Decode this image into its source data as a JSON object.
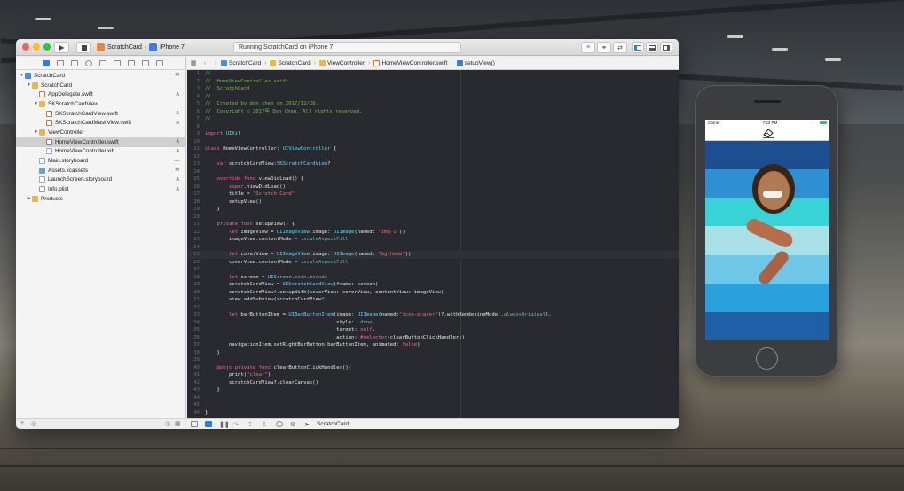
{
  "xcode": {
    "scheme": {
      "target": "ScratchCard",
      "device": "iPhone 7"
    },
    "activity": "Running ScratchCard on iPhone 7"
  },
  "navigator": {
    "items": [
      {
        "label": "ScratchCard",
        "badge": "M",
        "depth": 0,
        "kind": "proj",
        "open": true
      },
      {
        "label": "ScratchCard",
        "badge": "",
        "depth": 1,
        "kind": "folder",
        "open": true
      },
      {
        "label": "AppDelegate.swift",
        "badge": "A",
        "depth": 2,
        "kind": "swift"
      },
      {
        "label": "SKScratchCardView",
        "badge": "",
        "depth": 2,
        "kind": "folder",
        "open": true
      },
      {
        "label": "SKScratchCardView.swift",
        "badge": "A",
        "depth": 3,
        "kind": "swift"
      },
      {
        "label": "SKScratchCardMaskView.swift",
        "badge": "A",
        "depth": 3,
        "kind": "swift"
      },
      {
        "label": "ViewController",
        "badge": "",
        "depth": 2,
        "kind": "folder",
        "open": true
      },
      {
        "label": "HomeViewController.swift",
        "badge": "A",
        "depth": 3,
        "kind": "swift",
        "selected": true
      },
      {
        "label": "HomeViewController.xib",
        "badge": "A",
        "depth": 3,
        "kind": "xib"
      },
      {
        "label": "Main.storyboard",
        "badge": "—",
        "depth": 2,
        "kind": "xib"
      },
      {
        "label": "Assets.xcassets",
        "badge": "M",
        "depth": 2,
        "kind": "assets"
      },
      {
        "label": "LaunchScreen.storyboard",
        "badge": "A",
        "depth": 2,
        "kind": "xib"
      },
      {
        "label": "Info.plist",
        "badge": "A",
        "depth": 2,
        "kind": "plist"
      },
      {
        "label": "Products",
        "badge": "",
        "depth": 1,
        "kind": "folder",
        "open": false
      }
    ]
  },
  "jumpbar": {
    "items": [
      "ScratchCard",
      "ScratchCard",
      "ViewController",
      "HomeViewController.swift",
      "setupView()"
    ]
  },
  "code": {
    "highlight_line": 25,
    "lines": [
      "//",
      "//  HomeViewController.swift",
      "//  ScratchCard",
      "//",
      "//  Created by don chen on 2017/12/26.",
      "//  Copyright © 2017年 Don Chen. All rights reserved.",
      "//",
      "",
      "import UIKit",
      "",
      "class HomeViewController: UIViewController {",
      "",
      "    var scratchCardView:SKScratchCardView?",
      "",
      "    override func viewDidLoad() {",
      "        super.viewDidLoad()",
      "        title = \"Scratch Card\"",
      "        setupView()",
      "    }",
      "",
      "    private func setupView() {",
      "        let imageView = UIImageView(image: UIImage(named: \"img-1\"))",
      "        imageView.contentMode = .scaleAspectFill",
      "",
      "        let coverView = UIImageView(image: UIImage(named: \"bg-home\"))",
      "        coverView.contentMode = .scaleAspectFill",
      "",
      "        let screen = UIScreen.main.bounds",
      "        scratchCardView = SKScratchCardView(frame: screen)",
      "        scratchCardView!.setupWith(coverView: coverView, contentView: imageView)",
      "        view.addSubview(scratchCardView!)",
      "",
      "        let barButtonItem = UIBarButtonItem(image: UIImage(named:\"icon-eraser\")?.withRenderingMode(.alwaysOriginal),",
      "                                            style: .done,",
      "                                            target: self,",
      "                                            action: #selector(clearButtonClickHandler))",
      "        navigationItem.setRightBarButton(barButtonItem, animated: false)",
      "    }",
      "",
      "    @objc private func clearButtonClickHandler(){",
      "        print(\"clear\")",
      "        scratchCardView?.clearCanvas()",
      "    }",
      "",
      "",
      "}"
    ]
  },
  "debugbar": {
    "target": "ScratchCard"
  },
  "simulator": {
    "carrier": "Carrier",
    "time": "7:23 PM",
    "nav_icon": "eraser-icon",
    "stripe_colors": [
      "#1c4f8f",
      "#2e8fd3",
      "#38d3d7",
      "#a9dfe6",
      "#6fc7e8",
      "#2aa0dc",
      "#1f5fa8"
    ]
  }
}
